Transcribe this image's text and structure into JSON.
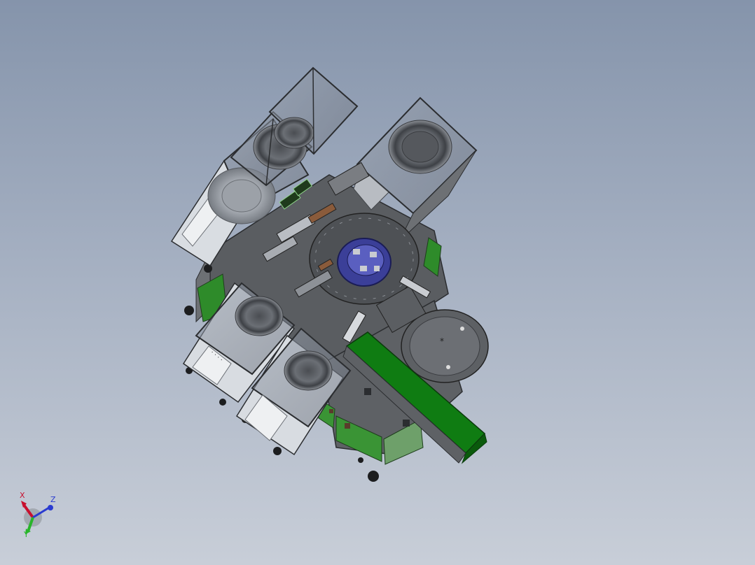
{
  "viewport": {
    "background_top": "#8594ab",
    "background_bottom": "#c8ced8"
  },
  "model": {
    "frame_color": "#5e6165",
    "panel_green": "#2e8b2a",
    "conveyor_green": "#0f7c12",
    "turntable_blue": "#3b3f98",
    "steel_gray": "#6f7276"
  },
  "triad": {
    "x_label": "X",
    "y_label": "Y",
    "z_label": "Z",
    "x_color": "#c8102e",
    "y_color": "#28b52a",
    "z_color": "#2a3bd0"
  }
}
